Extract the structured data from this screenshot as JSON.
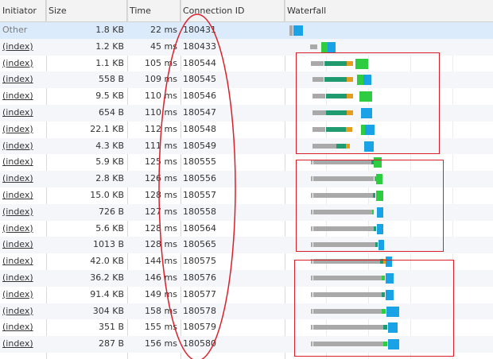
{
  "columns": {
    "initiator": "Initiator",
    "size": "Size",
    "time": "Time",
    "connection_id": "Connection ID",
    "waterfall": "Waterfall"
  },
  "colors": {
    "stalled": "#a9a9a9",
    "connect": "#e29e1f",
    "ssl": "#8e44ad",
    "waiting": "#1f9b6f",
    "waiting_green": "#2ecc40",
    "download": "#1aa2e6",
    "annotation": "#d9202a"
  },
  "rows": [
    {
      "initiator": "Other",
      "size": "1.8 KB",
      "time": "22 ms",
      "conn": "180431",
      "link": false
    },
    {
      "initiator": "(index)",
      "size": "1.2 KB",
      "time": "45 ms",
      "conn": "180433",
      "link": true
    },
    {
      "initiator": "(index)",
      "size": "1.1 KB",
      "time": "105 ms",
      "conn": "180544",
      "link": true
    },
    {
      "initiator": "(index)",
      "size": "558 B",
      "time": "109 ms",
      "conn": "180545",
      "link": true
    },
    {
      "initiator": "(index)",
      "size": "9.5 KB",
      "time": "110 ms",
      "conn": "180546",
      "link": true
    },
    {
      "initiator": "(index)",
      "size": "654 B",
      "time": "110 ms",
      "conn": "180547",
      "link": true
    },
    {
      "initiator": "(index)",
      "size": "22.1 KB",
      "time": "112 ms",
      "conn": "180548",
      "link": true
    },
    {
      "initiator": "(index)",
      "size": "4.3 KB",
      "time": "111 ms",
      "conn": "180549",
      "link": true
    },
    {
      "initiator": "(index)",
      "size": "5.9 KB",
      "time": "125 ms",
      "conn": "180555",
      "link": true
    },
    {
      "initiator": "(index)",
      "size": "2.8 KB",
      "time": "126 ms",
      "conn": "180556",
      "link": true
    },
    {
      "initiator": "(index)",
      "size": "15.0 KB",
      "time": "128 ms",
      "conn": "180557",
      "link": true
    },
    {
      "initiator": "(index)",
      "size": "726 B",
      "time": "127 ms",
      "conn": "180558",
      "link": true
    },
    {
      "initiator": "(index)",
      "size": "5.6 KB",
      "time": "128 ms",
      "conn": "180564",
      "link": true
    },
    {
      "initiator": "(index)",
      "size": "1013 B",
      "time": "128 ms",
      "conn": "180565",
      "link": true
    },
    {
      "initiator": "(index)",
      "size": "42.0 KB",
      "time": "144 ms",
      "conn": "180575",
      "link": true
    },
    {
      "initiator": "(index)",
      "size": "36.2 KB",
      "time": "146 ms",
      "conn": "180576",
      "link": true
    },
    {
      "initiator": "(index)",
      "size": "91.4 KB",
      "time": "149 ms",
      "conn": "180577",
      "link": true
    },
    {
      "initiator": "(index)",
      "size": "304 KB",
      "time": "158 ms",
      "conn": "180578",
      "link": true
    },
    {
      "initiator": "(index)",
      "size": "351 B",
      "time": "155 ms",
      "conn": "180579",
      "link": true
    },
    {
      "initiator": "(index)",
      "size": "287 B",
      "time": "156 ms",
      "conn": "180580",
      "link": true
    }
  ]
}
